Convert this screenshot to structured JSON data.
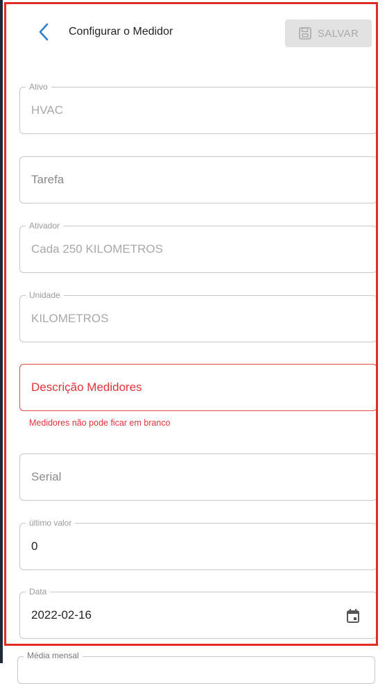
{
  "header": {
    "title": "Configurar o Medidor",
    "save_label": "SALVAR"
  },
  "fields": {
    "ativo": {
      "label": "Ativo",
      "value": "HVAC"
    },
    "tarefa": {
      "placeholder": "Tarefa"
    },
    "ativador": {
      "label": "Ativador",
      "value": "Cada 250 KILOMETROS"
    },
    "unidade": {
      "label": "Unidade",
      "value": "KILOMETROS"
    },
    "descricao": {
      "placeholder": "Descrição Medidores",
      "error": "Medidores não pode ficar em branco"
    },
    "serial": {
      "placeholder": "Serial"
    },
    "ultimo_valor": {
      "label": "último valor",
      "value": "0"
    },
    "data": {
      "label": "Data",
      "value": "2022-02-16"
    },
    "media_mensal": {
      "label": "Média mensal"
    }
  },
  "colors": {
    "accent": "#2f7dd1",
    "error": "#e0343b",
    "highlight_border": "#e02d24"
  }
}
